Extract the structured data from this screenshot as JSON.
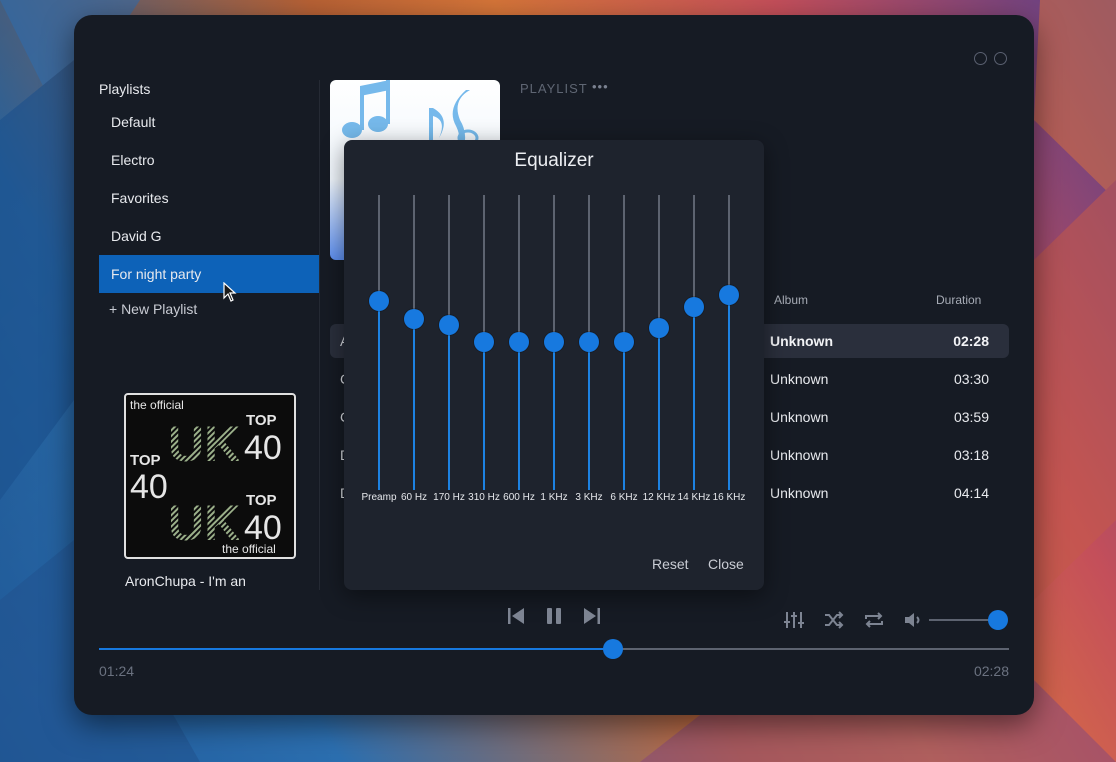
{
  "sidebar": {
    "title": "Playlists",
    "items": [
      {
        "label": "Default"
      },
      {
        "label": "Electro"
      },
      {
        "label": "Favorites"
      },
      {
        "label": "David G"
      },
      {
        "label": "For night party",
        "active": true
      }
    ],
    "new_playlist": "+ New Playlist"
  },
  "now_playing": {
    "cover_text_top": "the official",
    "cover_text_bottom": "the official",
    "cover_uk": "UK",
    "cover_top": "TOP",
    "cover_40": "40",
    "title": "AronChupa - I'm an"
  },
  "playlist_header": {
    "label": "PLAYLIST",
    "more": "•••"
  },
  "track_table": {
    "columns": {
      "album": "Album",
      "duration": "Duration"
    },
    "rows": [
      {
        "first": "A",
        "album": "Unknown",
        "duration": "02:28",
        "active": true
      },
      {
        "first": "C",
        "album": "Unknown",
        "duration": "03:30"
      },
      {
        "first": "C",
        "album": "Unknown",
        "duration": "03:59"
      },
      {
        "first": "D",
        "album": "Unknown",
        "duration": "03:18"
      },
      {
        "first": "D",
        "album": "Unknown",
        "duration": "04:14"
      }
    ]
  },
  "equalizer": {
    "title": "Equalizer",
    "bands": [
      {
        "label": "Preamp",
        "level": 0.64
      },
      {
        "label": "60 Hz",
        "level": 0.58
      },
      {
        "label": "170 Hz",
        "level": 0.56
      },
      {
        "label": "310 Hz",
        "level": 0.5
      },
      {
        "label": "600 Hz",
        "level": 0.5
      },
      {
        "label": "1 KHz",
        "level": 0.5
      },
      {
        "label": "3 KHz",
        "level": 0.5
      },
      {
        "label": "6 KHz",
        "level": 0.5
      },
      {
        "label": "12 KHz",
        "level": 0.55
      },
      {
        "label": "14 KHz",
        "level": 0.62
      },
      {
        "label": "16 KHz",
        "level": 0.66
      }
    ],
    "reset_label": "Reset",
    "close_label": "Close"
  },
  "playback": {
    "elapsed": "01:24",
    "total": "02:28",
    "progress": 0.565,
    "volume": 1.0
  },
  "icons": {
    "prev": "skip-back-icon",
    "pause": "pause-icon",
    "next": "skip-forward-icon",
    "equalizer": "equalizer-icon",
    "shuffle": "shuffle-icon",
    "repeat": "repeat-icon",
    "volume": "volume-icon"
  },
  "colors": {
    "accent": "#1779df",
    "active_item": "#0d62b8",
    "window_bg": "#161b24",
    "eq_bg": "#1e232d"
  }
}
